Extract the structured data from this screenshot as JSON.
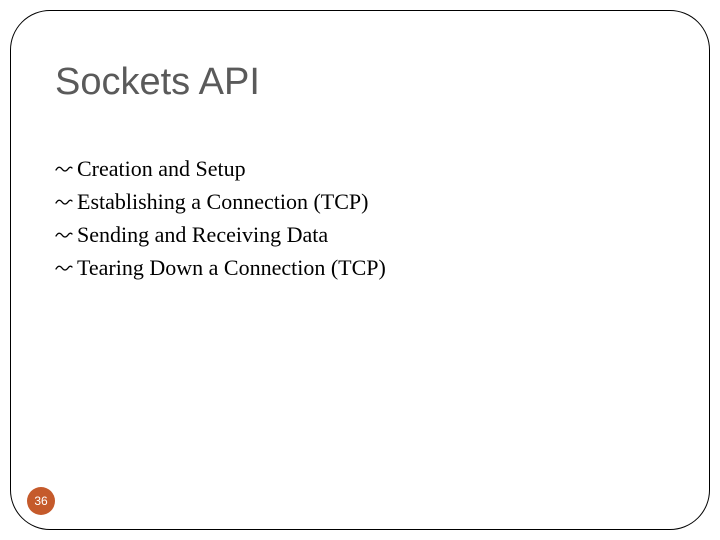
{
  "title": "Sockets API",
  "bullets": [
    "Creation and Setup",
    "Establishing a Connection (TCP)",
    "Sending and Receiving Data",
    "Tearing Down a Connection (TCP)"
  ],
  "pageNumber": "36"
}
